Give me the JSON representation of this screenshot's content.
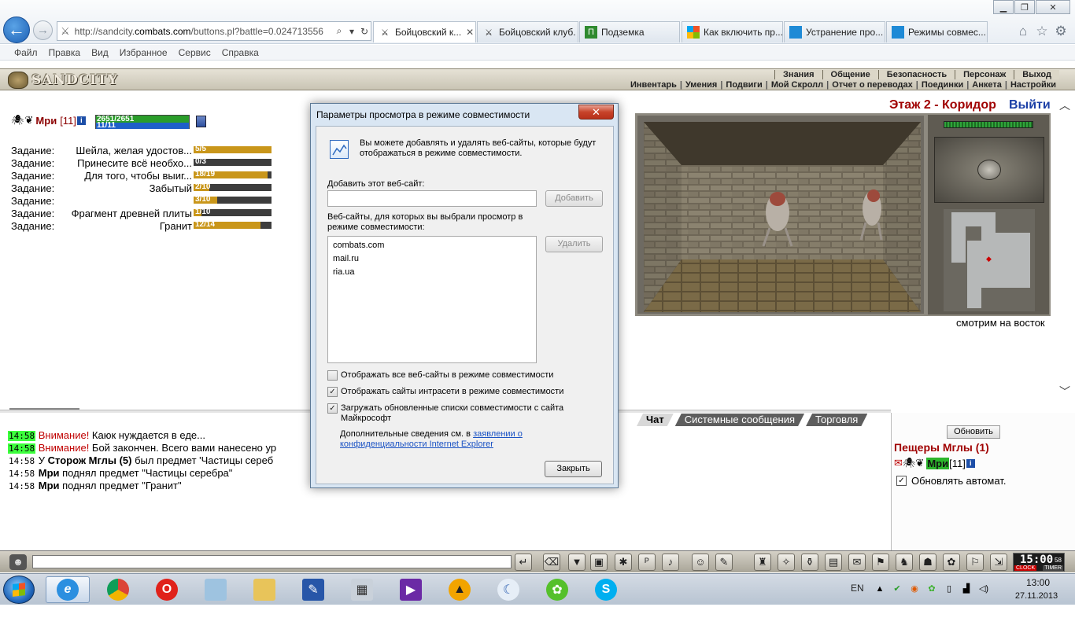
{
  "browser": {
    "address_prefix": "http://sandcity.",
    "address_domain": "combats.com",
    "address_suffix": "/buttons.pl?battle=0.024713556",
    "tabs": [
      {
        "label": "Бойцовский к...",
        "active": true
      },
      {
        "label": "Бойцовский клуб."
      },
      {
        "label": "Подземка"
      },
      {
        "label": "Как включить пр..."
      },
      {
        "label": "Устранение про..."
      },
      {
        "label": "Режимы совмес..."
      }
    ],
    "menu": [
      "Файл",
      "Правка",
      "Вид",
      "Избранное",
      "Сервис",
      "Справка"
    ]
  },
  "game": {
    "logo": "SANDCITY",
    "top_menu": [
      "Знания",
      "Общение",
      "Безопасность",
      "Персонаж",
      "Выход"
    ],
    "sub_menu": [
      "Инвентарь",
      "Умения",
      "Подвиги",
      "Мой Скролл",
      "Отчет о переводах",
      "Поединки",
      "Анкета",
      "Настройки"
    ],
    "character": {
      "name": "Мри",
      "level": "[11]",
      "hp": "2651/2651",
      "mp": "11/11"
    },
    "tasks": [
      {
        "label": "Задание:",
        "text": "Шейла, желая удостов...",
        "value": "5/5",
        "fraction": 1.0
      },
      {
        "label": "Задание:",
        "text": "Принесите всё необхо...",
        "value": "0/3",
        "fraction": 0.0
      },
      {
        "label": "Задание:",
        "text": "Для того, чтобы выиг...",
        "value": "18/19",
        "fraction": 0.947
      },
      {
        "label": "Задание:",
        "text": "Забытый",
        "value": "2/10",
        "fraction": 0.2
      },
      {
        "label": "Задание:",
        "text": "",
        "value": "3/10",
        "fraction": 0.3
      },
      {
        "label": "Задание:",
        "text": "Фрагмент древней плиты",
        "value": "1/10",
        "fraction": 0.1
      },
      {
        "label": "Задание:",
        "text": "Гранит",
        "value": "12/14",
        "fraction": 0.857
      }
    ],
    "room_title": "Этаж 2 - Коридор",
    "exit_label": "Выйти",
    "view_caption": "смотрим на восток",
    "chat_tabs": [
      "Чат",
      "Системные сообщения",
      "Торговля"
    ],
    "chat": [
      {
        "time": "14:58",
        "highlight": true,
        "warn": "Внимание!",
        "text": " Каюк нуждается в еде..."
      },
      {
        "time": "14:58",
        "highlight": true,
        "warn": "Внимание!",
        "text": " Бой закончен. Всего вами нанесено ур"
      },
      {
        "time": "14:58",
        "pre": " У ",
        "nick": "Сторож Мглы (5)",
        "text": " был предмет 'Частицы сереб"
      },
      {
        "time": "14:58",
        "nick": " Мри",
        "text": " поднял предмет \"Частицы серебра\""
      },
      {
        "time": "14:58",
        "nick": " Мри",
        "text": " поднял предмет \"Гранит\""
      }
    ],
    "location": {
      "refresh": "Обновить",
      "title": "Пещеры Мглы (1)",
      "user": "Мри",
      "level": "[11]",
      "auto_refresh": "Обновлять автомат."
    },
    "clock": {
      "time": "15:00",
      "seconds": "58",
      "clock_label": "CLOCK",
      "timer_label": "TIMER"
    }
  },
  "dialog": {
    "title": "Параметры просмотра в режиме совместимости",
    "intro": "Вы можете добавлять и удалять веб-сайты, которые будут отображаться в режиме совместимости.",
    "add_label": "Добавить этот веб-сайт:",
    "add_value": "",
    "add_button": "Добавить",
    "list_label": "Веб-сайты, для которых вы выбрали просмотр в режиме совместимости:",
    "sites": [
      "combats.com",
      "mail.ru",
      "ria.ua"
    ],
    "remove_button": "Удалить",
    "checkboxes": [
      {
        "label": "Отображать все веб-сайты в режиме совместимости",
        "checked": false
      },
      {
        "label": "Отображать сайты интрасети в режиме совместимости",
        "checked": true
      },
      {
        "label": "Загружать обновленные списки совместимости с сайта Майкрософт",
        "checked": true
      }
    ],
    "more_info_prefix": "Дополнительные сведения см. в ",
    "more_info_link": "заявлении о конфиденциальности Internet Explorer",
    "close_button": "Закрыть"
  },
  "taskbar": {
    "lang": "EN",
    "time": "13:00",
    "date": "27.11.2013"
  }
}
